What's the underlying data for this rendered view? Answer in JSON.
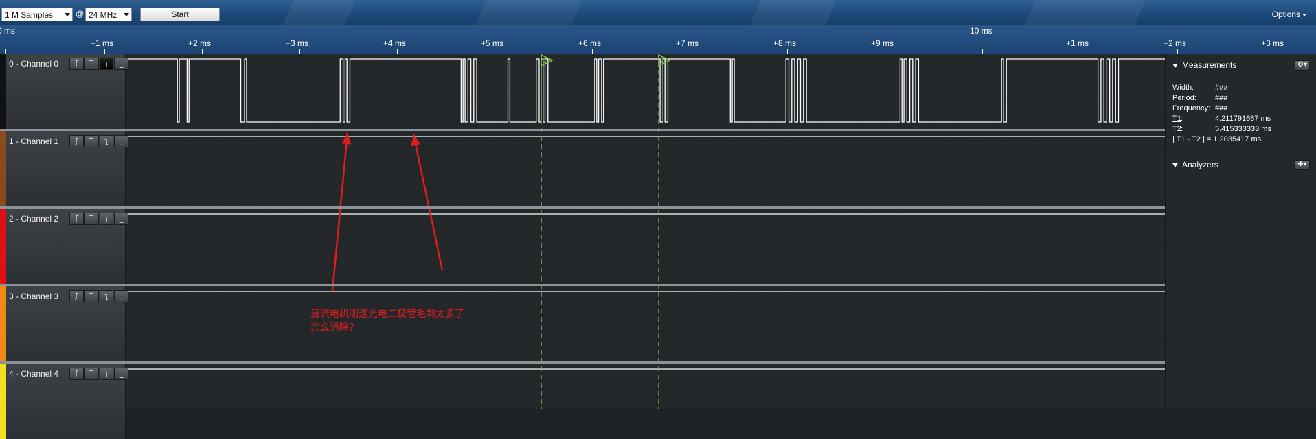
{
  "toolbar": {
    "samples": "1 M Samples",
    "at_sign": "@",
    "rate": "24 MHz",
    "start_label": "Start",
    "options_label": "Options"
  },
  "ruler": {
    "start_label": "0 ms",
    "major_label": "10 ms",
    "ticks": [
      "+1 ms",
      "+2 ms",
      "+3 ms",
      "+4 ms",
      "+5 ms",
      "+6 ms",
      "+7 ms",
      "+8 ms",
      "+9 ms",
      "+1 ms",
      "+2 ms",
      "+3 ms"
    ]
  },
  "channels": [
    {
      "label": "0 - Channel 0",
      "color": "#111111"
    },
    {
      "label": "1 - Channel 1",
      "color": "#8a4a1a"
    },
    {
      "label": "2 - Channel 2",
      "color": "#e01010"
    },
    {
      "label": "3 - Channel 3",
      "color": "#f08a10"
    },
    {
      "label": "4 - Channel 4",
      "color": "#f0e020"
    }
  ],
  "trigger_buttons": [
    "rising-edge",
    "high",
    "falling-edge",
    "low"
  ],
  "markers": [
    {
      "label": "1",
      "time_ms": 4.2118
    },
    {
      "label": "2",
      "time_ms": 5.4153
    }
  ],
  "measurements": {
    "title": "Measurements",
    "width_key": "Width:",
    "width_val": "###",
    "period_key": "Period:",
    "period_val": "###",
    "frequency_key": "Frequency:",
    "frequency_val": "###",
    "t1_key": "T1",
    "t1_val": "4.211791667 ms",
    "t2_key": "T2",
    "t2_val": "5.415333333 ms",
    "diff": "| T1 - T2 | = 1.2035417 ms"
  },
  "analyzers": {
    "title": "Analyzers"
  },
  "annotation": {
    "line1": "直流电机测速光电二极管毛刺太多了",
    "line2": "怎么消除？",
    "color": "#e11c1c"
  },
  "colors": {
    "marker": "#7bc043",
    "arrow": "#e11c1c"
  }
}
